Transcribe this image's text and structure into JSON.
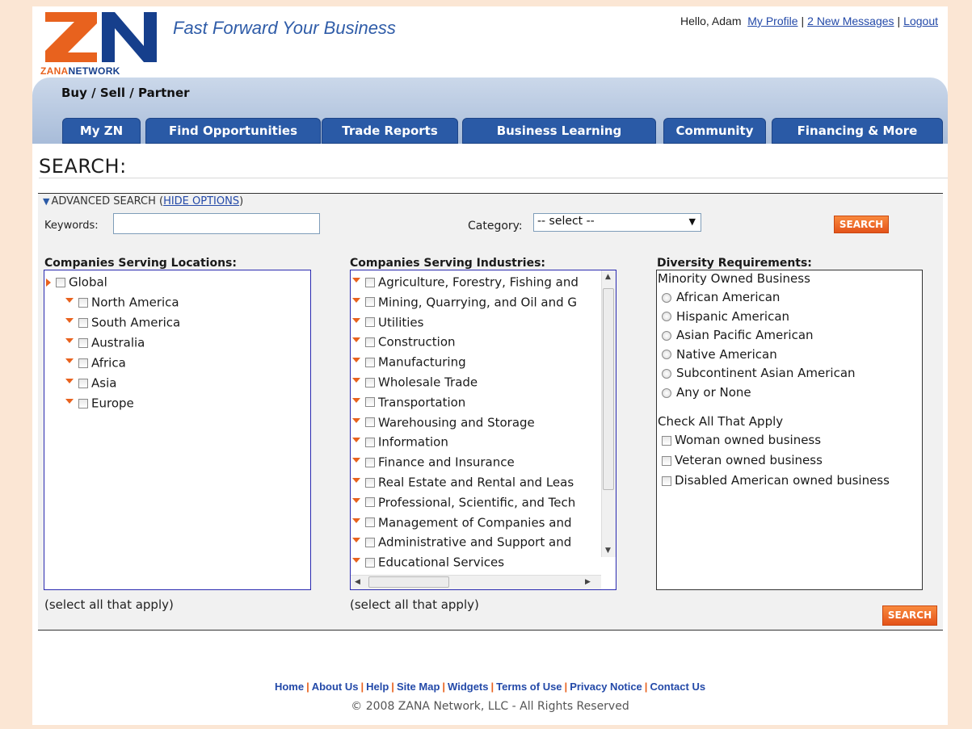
{
  "header": {
    "logo_alt": "ZN",
    "logo_word_1": "ZANA",
    "logo_word_2": "NETWORK",
    "tagline": "Fast Forward Your Business",
    "greeting": "Hello, Adam",
    "links": [
      "My Profile",
      "2 New Messages",
      "Logout"
    ]
  },
  "nav": {
    "subtitle": "Buy / Sell / Partner",
    "tabs": [
      "My ZN",
      "Find Opportunities",
      "Trade Reports",
      "Business Learning",
      "Community",
      "Financing & More"
    ]
  },
  "page_title": "SEARCH:",
  "advanced": {
    "label": "ADVANCED SEARCH (",
    "link": "HIDE OPTIONS",
    "close": ")"
  },
  "keywords": {
    "label": "Keywords:",
    "value": ""
  },
  "category": {
    "label": "Category:",
    "selected": "-- select --"
  },
  "search_button": "SEARCH",
  "locations": {
    "heading": "Companies Serving Locations:",
    "root": "Global",
    "items": [
      "North America",
      "South America",
      "Australia",
      "Africa",
      "Asia",
      "Europe"
    ],
    "note": "(select all that apply)"
  },
  "industries": {
    "heading": "Companies Serving Industries:",
    "items": [
      "Agriculture, Forestry, Fishing and",
      "Mining, Quarrying, and Oil and G",
      "Utilities",
      "Construction",
      "Manufacturing",
      "Wholesale Trade",
      "Transportation",
      "Warehousing and Storage",
      "Information",
      "Finance and Insurance",
      "Real Estate and Rental and Leas",
      "Professional, Scientific, and Tech",
      "Management of Companies and",
      "Administrative and Support and",
      "Educational Services"
    ],
    "note": "(select all that apply)"
  },
  "diversity": {
    "heading": "Diversity Requirements:",
    "minority_label": "Minority Owned Business",
    "minority_options": [
      "African American",
      "Hispanic American",
      "Asian Pacific American",
      "Native American",
      "Subcontinent Asian American",
      "Any or None"
    ],
    "check_label": "Check All That Apply",
    "check_options": [
      "Woman owned business",
      "Veteran owned business",
      "Disabled American owned business"
    ]
  },
  "footer": {
    "links": [
      "Home",
      "About Us",
      "Help",
      "Site Map",
      "Widgets",
      "Terms of Use",
      "Privacy Notice",
      "Contact Us"
    ],
    "copyright": "© 2008 ZANA Network, LLC - All Rights Reserved"
  },
  "colors": {
    "brand_orange": "#e8621e",
    "brand_blue": "#163f8c",
    "tab_blue": "#2a5aa6",
    "link_blue": "#2349a8",
    "page_bg": "#fbe6d4"
  }
}
